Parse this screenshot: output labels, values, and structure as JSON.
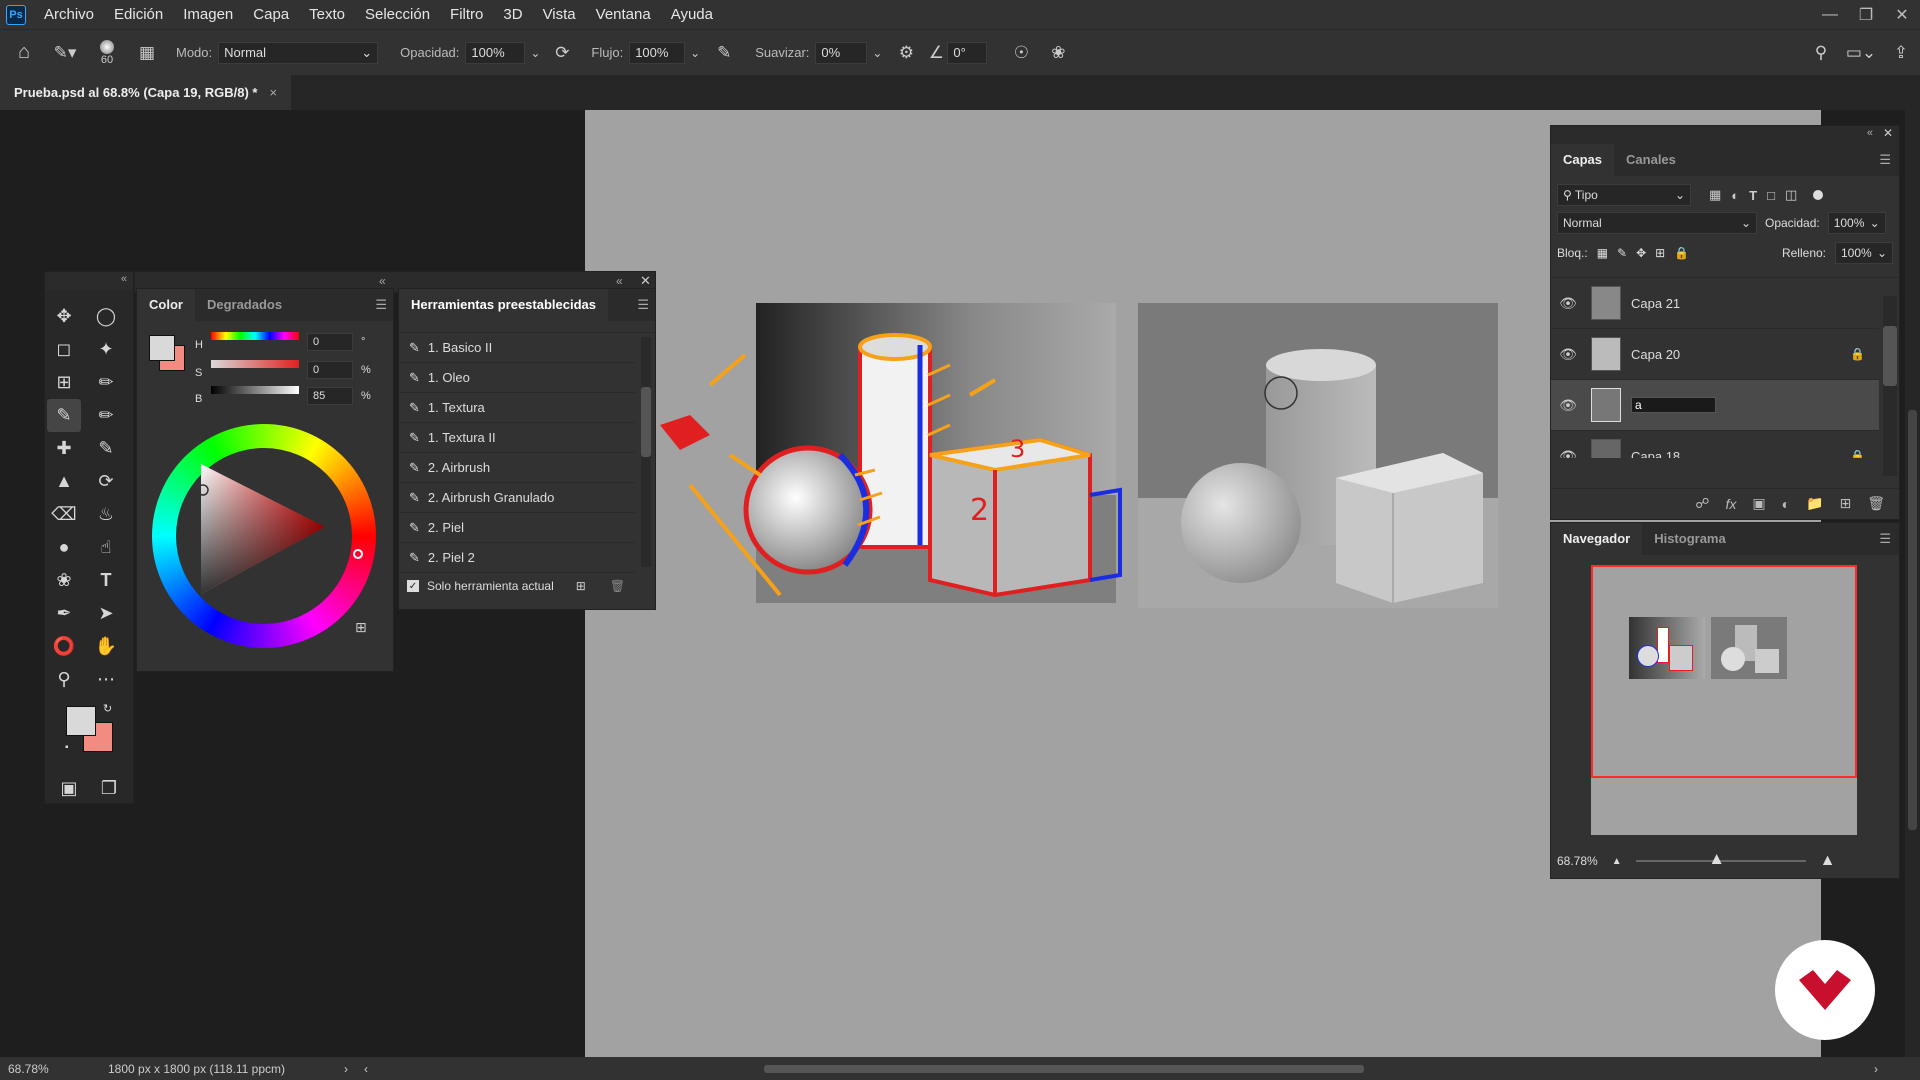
{
  "app": {
    "logo": "Ps"
  },
  "menu": [
    "Archivo",
    "Edición",
    "Imagen",
    "Capa",
    "Texto",
    "Selección",
    "Filtro",
    "3D",
    "Vista",
    "Ventana",
    "Ayuda"
  ],
  "options": {
    "brush_size": "60",
    "mode_label": "Modo:",
    "mode_value": "Normal",
    "opacity_label": "Opacidad:",
    "opacity_value": "100%",
    "flow_label": "Flujo:",
    "flow_value": "100%",
    "smooth_label": "Suavizar:",
    "smooth_value": "0%",
    "angle_value": "0°"
  },
  "document_tab": {
    "title": "Prueba.psd al 68.8% (Capa 19, RGB/8) *",
    "close": "×"
  },
  "color_panel": {
    "tabs": [
      "Color",
      "Degradados"
    ],
    "h_label": "H",
    "h_value": "0",
    "h_unit": "°",
    "s_label": "S",
    "s_value": "0",
    "s_unit": "%",
    "b_label": "B",
    "b_value": "85",
    "b_unit": "%",
    "foreground": "#d9d9d9",
    "background": "#f28b82"
  },
  "presets_panel": {
    "title": "Herramientas preestablecidas",
    "items": [
      "1. Basico II",
      "1. Oleo",
      "1. Textura",
      "1. Textura II",
      "2. Airbrush",
      "2. Airbrush Granulado",
      "2. Piel",
      "2. Piel 2"
    ],
    "footer_label": "Solo herramienta actual"
  },
  "layers_panel": {
    "tabs": [
      "Capas",
      "Canales"
    ],
    "filter_label": "Tipo",
    "blend_mode": "Normal",
    "opacity_label": "Opacidad:",
    "opacity_value": "100%",
    "lock_label": "Bloq.:",
    "fill_label": "Relleno:",
    "fill_value": "100%",
    "layers": [
      {
        "name": "Capa 21",
        "locked": false
      },
      {
        "name": "Capa 20",
        "locked": true
      },
      {
        "name": "a",
        "locked": false,
        "editing": true
      },
      {
        "name": "Capa 18",
        "locked": true
      }
    ]
  },
  "navigator_panel": {
    "tabs": [
      "Navegador",
      "Histograma"
    ],
    "zoom": "68.78%"
  },
  "status": {
    "zoom": "68.78%",
    "doc_info": "1800 px x 1800 px (118.11 ppcm)"
  },
  "colors": {
    "accent_red": "#e02020",
    "sketch_blue": "#1a2ee0",
    "sketch_orange": "#f5a11a"
  }
}
